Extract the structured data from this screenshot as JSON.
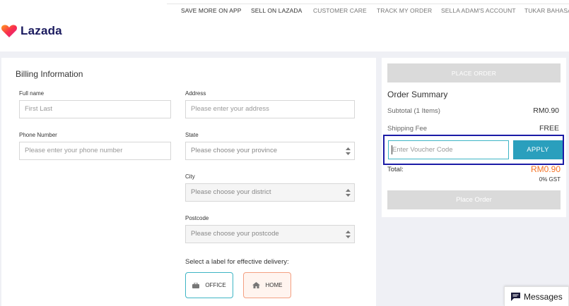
{
  "nav": {
    "items": [
      "SAVE MORE ON APP",
      "SELL ON LAZADA",
      "CUSTOMER CARE",
      "TRACK MY ORDER",
      "SELLA ADAM'S ACCOUNT",
      "TUKAR BAHASA"
    ]
  },
  "logo": {
    "text": "Lazada",
    "icon": "lazada-heart-icon"
  },
  "billing": {
    "title": "Billing Information",
    "full_name": {
      "label": "Full name",
      "placeholder": "First Last"
    },
    "phone": {
      "label": "Phone Number",
      "placeholder": "Please enter your phone number"
    },
    "address": {
      "label": "Address",
      "placeholder": "Please enter your address"
    },
    "state": {
      "label": "State",
      "placeholder": "Please choose your province"
    },
    "city": {
      "label": "City",
      "placeholder": "Please choose your district"
    },
    "postcode": {
      "label": "Postcode",
      "placeholder": "Please choose your postcode"
    },
    "delivery_label": "Select a label for effective delivery:",
    "office": {
      "label": "OFFICE",
      "icon": "briefcase-icon"
    },
    "home": {
      "label": "HOME",
      "icon": "house-icon"
    }
  },
  "summary": {
    "place_order_top": "PLACE ORDER",
    "title": "Order Summary",
    "subtotal_label": "Subtotal (1 Items)",
    "subtotal_value": "RM0.90",
    "shipping_label": "Shipping Fee",
    "shipping_value": "FREE",
    "voucher_placeholder": "Enter Voucher Code",
    "apply_label": "APPLY",
    "total_label": "Total:",
    "total_value": "RM0.90",
    "gst": "0% GST",
    "place_order_bottom": "Place Order"
  },
  "messages": {
    "label": "Messages",
    "icon": "chat-icon"
  },
  "colors": {
    "accent": "#2a9fbd",
    "price": "#f57224",
    "highlight_box": "#1b1ba6",
    "disabled_button": "#dadada"
  }
}
